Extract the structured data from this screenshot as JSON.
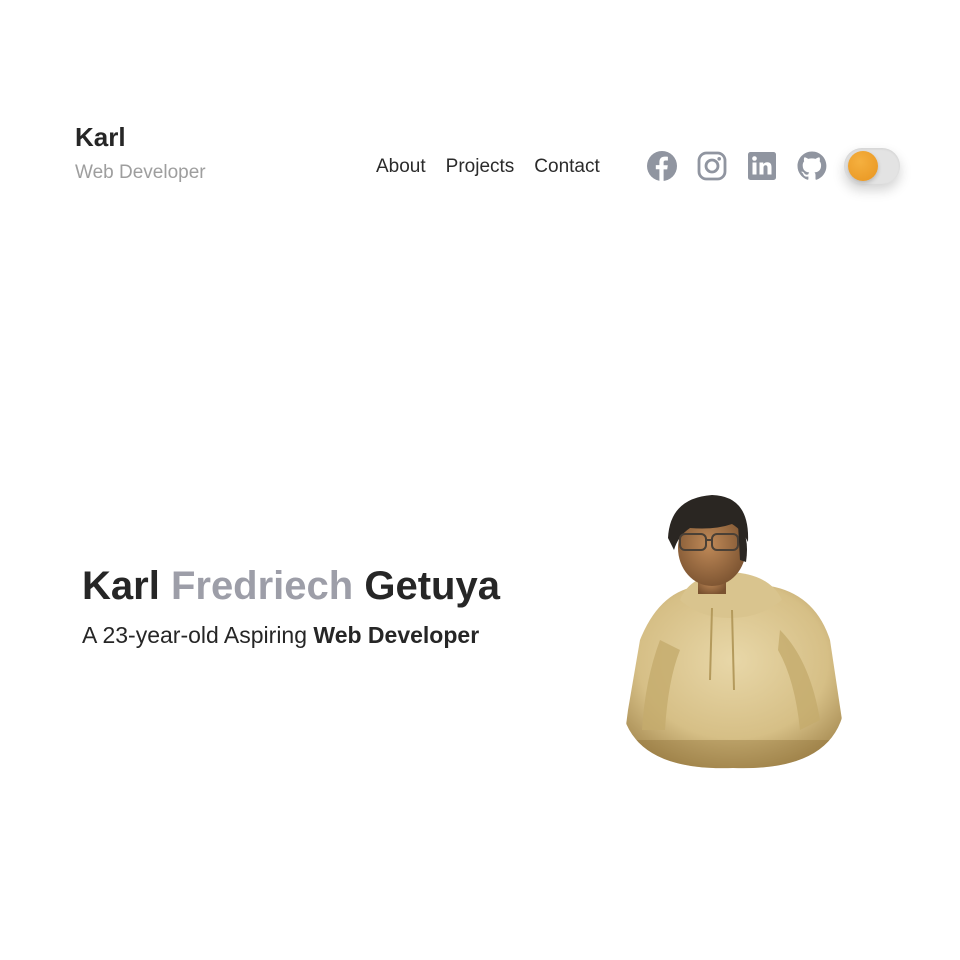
{
  "header": {
    "brand_name": "Karl",
    "brand_subtitle": "Web Developer",
    "nav": [
      {
        "label": "About"
      },
      {
        "label": "Projects"
      },
      {
        "label": "Contact"
      }
    ],
    "socials": [
      {
        "icon": "facebook-icon"
      },
      {
        "icon": "instagram-icon"
      },
      {
        "icon": "linkedin-icon"
      },
      {
        "icon": "github-icon"
      }
    ],
    "theme_toggle": {
      "accent": "#f0a030",
      "state": "light"
    }
  },
  "hero": {
    "name_first": "Karl",
    "name_middle": "Fredriech",
    "name_last": "Getuya",
    "tagline_prefix": "A 23-year-old Aspiring",
    "tagline_role": "Web Developer",
    "portrait_icon": "profile-photo"
  },
  "colors": {
    "text": "#262626",
    "muted": "#9e9e9e",
    "name_accent": "#9d9ea8",
    "icon": "#9095a0"
  }
}
